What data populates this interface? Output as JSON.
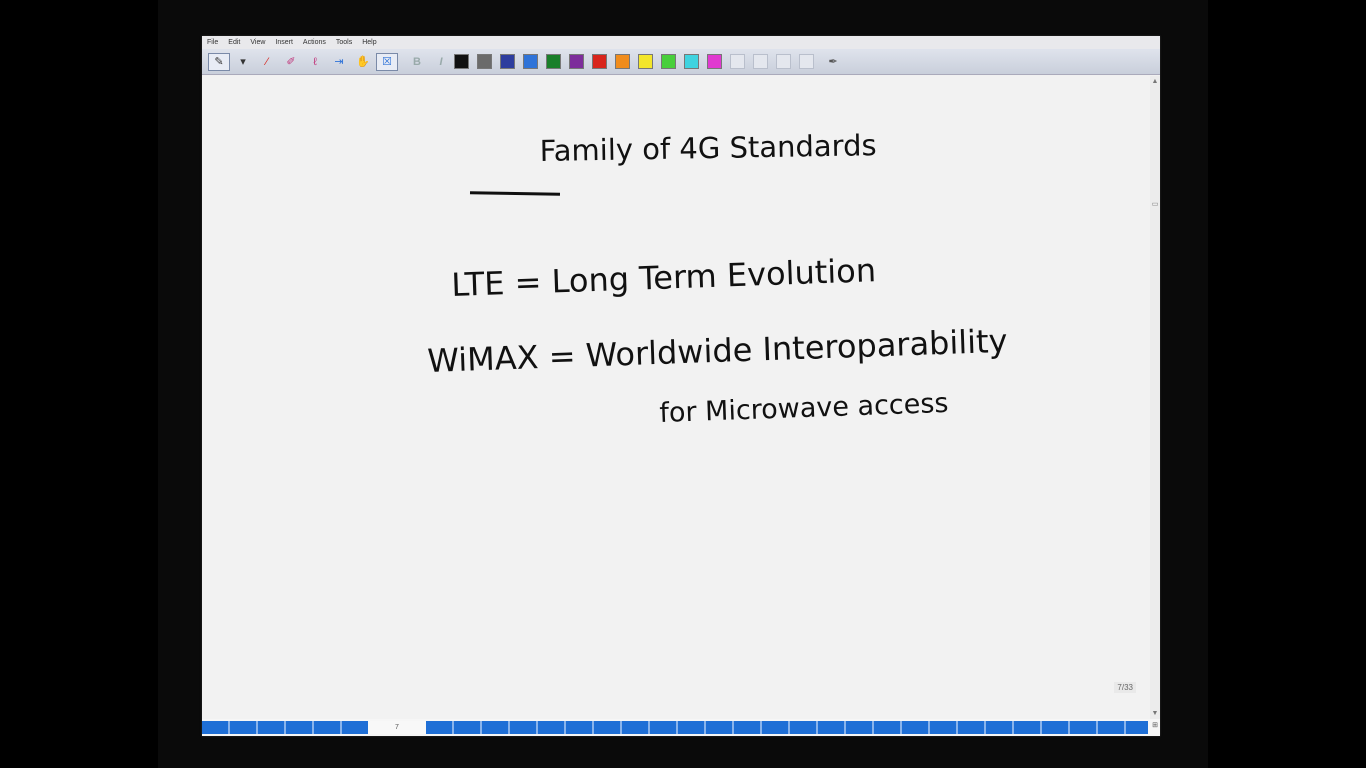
{
  "menu": [
    "File",
    "Edit",
    "View",
    "Insert",
    "Actions",
    "Tools",
    "Help"
  ],
  "toolbar": {
    "tools_left": [
      {
        "icon": "pen-icon",
        "glyph": "✎"
      },
      {
        "icon": "dropdown-arrow-icon",
        "glyph": "▾"
      },
      {
        "icon": "highlighter-icon",
        "glyph": "⁄"
      },
      {
        "icon": "eraser-icon",
        "glyph": "✐"
      },
      {
        "icon": "lasso-icon",
        "glyph": "ℓ"
      },
      {
        "icon": "insert-space-icon",
        "glyph": "⇥"
      },
      {
        "icon": "hand-tool-icon",
        "glyph": "✋"
      },
      {
        "icon": "insert-box-icon",
        "glyph": "☒"
      }
    ],
    "bold_label": "B",
    "italic_label": "I",
    "colors": [
      "#111111",
      "#6b6b6b",
      "#2d3d9e",
      "#2f73d8",
      "#1a7f2a",
      "#7d2d9b",
      "#d8251c",
      "#f08c1c",
      "#f3e62b",
      "#47cf3b",
      "#3fd3e0",
      "#e03ad0"
    ],
    "empty_swatches": 4,
    "trailing_icon": "custom-pen-icon"
  },
  "page": {
    "title": "Family of 4G Standards",
    "line1": "LTE = Long Term Evolution",
    "line2": "WiMAX = Worldwide Interoparability",
    "line3": "for Microwave access"
  },
  "status": {
    "page_indicator": "7/33",
    "current_page": "7"
  }
}
